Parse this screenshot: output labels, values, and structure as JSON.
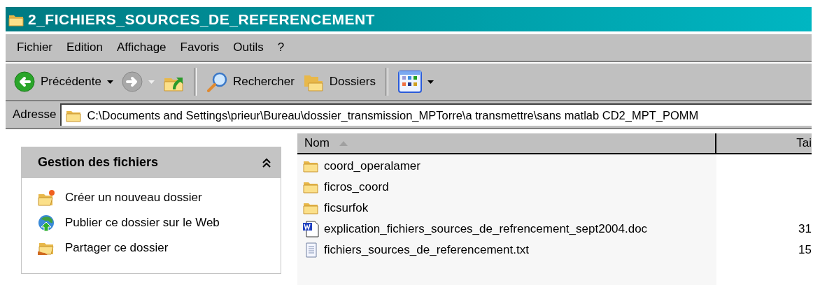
{
  "window": {
    "title": "2_FICHIERS_SOURCES_DE_REFERENCEMENT"
  },
  "menu": [
    {
      "label": "Fichier"
    },
    {
      "label": "Edition"
    },
    {
      "label": "Affichage"
    },
    {
      "label": "Favoris"
    },
    {
      "label": "Outils"
    },
    {
      "label": "?"
    }
  ],
  "toolbar": [
    {
      "kind": "back",
      "label": "Précédente",
      "disabled": false,
      "dropdown": true
    },
    {
      "kind": "forward",
      "disabled": true,
      "dropdown": true
    },
    {
      "kind": "up"
    },
    {
      "kind": "separator"
    },
    {
      "kind": "search",
      "label": "Rechercher"
    },
    {
      "kind": "folders",
      "label": "Dossiers"
    },
    {
      "kind": "separator"
    },
    {
      "kind": "views",
      "dropdown": true
    }
  ],
  "address": {
    "label": "Adresse",
    "value": "C:\\Documents and Settings\\prieur\\Bureau\\dossier_transmission_MPTorre\\a transmettre\\sans matlab CD2_MPT_POMM"
  },
  "tasks": {
    "title": "Gestion des fichiers",
    "expanded": true,
    "items": [
      {
        "kind": "new-folder",
        "label": "Créer un nouveau dossier"
      },
      {
        "kind": "publish",
        "label": "Publier ce dossier sur le Web"
      },
      {
        "kind": "share",
        "label": "Partager ce dossier"
      }
    ]
  },
  "file_list": {
    "columns": [
      {
        "label": "Nom",
        "sorted": true
      },
      {
        "label": "Tai",
        "sorted": false
      }
    ],
    "rows": [
      {
        "kind": "folder",
        "name": "coord_operalamer"
      },
      {
        "kind": "folder",
        "name": "ficros_coord"
      },
      {
        "kind": "folder",
        "name": "ficsurfok"
      },
      {
        "kind": "word",
        "name": "explication_fichiers_sources_de_refrencement_sept2004.doc",
        "size": "31"
      },
      {
        "kind": "text",
        "name": "fichiers_sources_de_referencement.txt",
        "size": "15"
      }
    ]
  }
}
